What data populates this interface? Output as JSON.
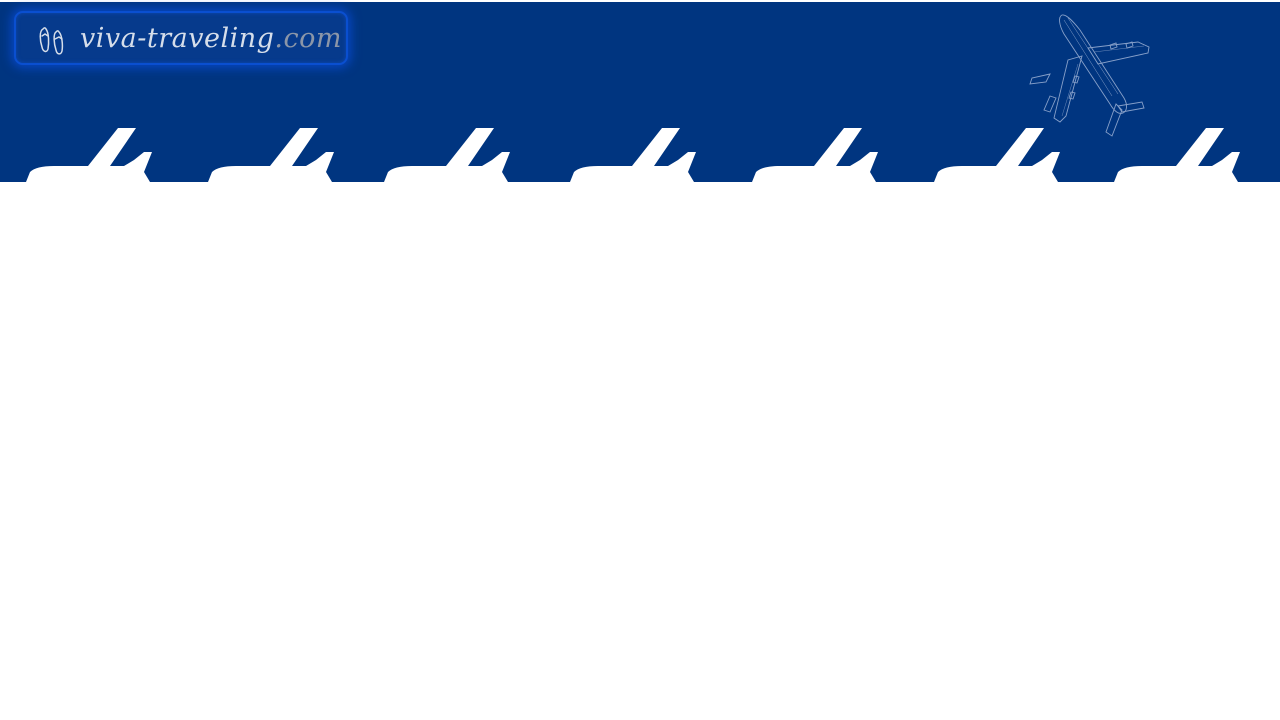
{
  "header": {
    "background_color": "#003580",
    "logo": {
      "icon": "flip-flops-icon",
      "name": "viva-traveling",
      "tld": ".com",
      "border_color": "#0a4fd0"
    },
    "decoration": {
      "plane": "airplane-blueprint-icon",
      "silhouette": "airplane-tail-silhouette-icon",
      "silhouette_count": 7,
      "silhouette_color": "#ffffff"
    }
  },
  "main": {
    "background_color": "#ffffff"
  }
}
